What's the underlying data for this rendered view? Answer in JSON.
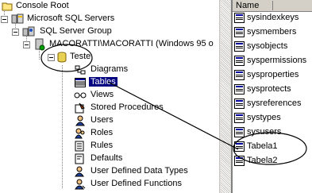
{
  "tree": {
    "root": "Console Root",
    "servers": "Microsoft SQL Servers",
    "group": "SQL Server Group",
    "server": "MACORATTI\\MACORATTI (Windows 95 o",
    "database": "Teste",
    "children": [
      "Diagrams",
      "Tables",
      "Views",
      "Stored Procedures",
      "Users",
      "Roles",
      "Rules",
      "Defaults",
      "User Defined Data Types",
      "User Defined Functions"
    ],
    "selected_item": "Tables"
  },
  "list": {
    "header": "Name",
    "items": [
      "sysindexkeys",
      "sysmembers",
      "sysobjects",
      "syspermissions",
      "sysproperties",
      "sysprotects",
      "sysreferences",
      "systypes",
      "sysusers",
      "Tabela1",
      "Tabela2"
    ]
  },
  "colors": {
    "selection": "#000080",
    "annotation": "#000000"
  }
}
